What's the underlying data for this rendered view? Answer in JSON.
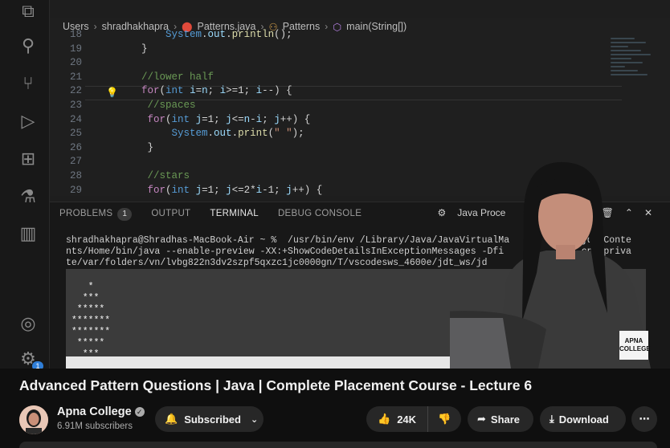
{
  "breadcrumb": [
    "Users",
    "shradhakhapra",
    "Patterns.java",
    "Patterns",
    "main(String[])"
  ],
  "editor": {
    "lines": [
      {
        "n": "18",
        "html": "    <span class='ty'>System</span>.<span class='vr'>out</span>.<span class='fn'>println</span>();"
      },
      {
        "n": "19",
        "html": "}"
      },
      {
        "n": "20",
        "html": ""
      },
      {
        "n": "21",
        "html": "<span class='cm'>//lower half</span>"
      },
      {
        "n": "22",
        "html": "<span class='kw'>for</span>(<span class='ty'>int</span> <span class='vr'>i</span>=<span class='vr'>n</span>; <span class='vr'>i</span>&gt;=1; <span class='vr'>i</span>--) {"
      },
      {
        "n": "23",
        "html": " <span class='cm'>//spaces</span>"
      },
      {
        "n": "24",
        "html": " <span class='kw'>for</span>(<span class='ty'>int</span> <span class='vr'>j</span>=1; <span class='vr'>j</span>&lt;=<span class='vr'>n</span>-<span class='vr'>i</span>; <span class='vr'>j</span>++) {"
      },
      {
        "n": "25",
        "html": "     <span class='ty'>System</span>.<span class='vr'>out</span>.<span class='fn'>print</span>(<span class='st'>\" \"</span>);"
      },
      {
        "n": "26",
        "html": " }"
      },
      {
        "n": "27",
        "html": ""
      },
      {
        "n": "28",
        "html": " <span class='cm'>//stars</span>"
      },
      {
        "n": "29",
        "html": " <span class='kw'>for</span>(<span class='ty'>int</span> <span class='vr'>j</span>=1; <span class='vr'>j</span>&lt;=2*<span class='vr'>i</span>-1; <span class='vr'>j</span>++) {"
      }
    ]
  },
  "panel": {
    "problems": "PROBLEMS",
    "problems_count": "1",
    "output": "OUTPUT",
    "terminal": "TERMINAL",
    "debug_console": "DEBUG CONSOLE",
    "java_process": "Java Proce"
  },
  "terminal": {
    "line1": "shradhakhapra@Shradhas-MacBook-Air ~ %  /usr/bin/env /Library/Java/JavaVirtualMa          .1.jdk/Conte",
    "line2": "nts/Home/bin/java --enable-preview -XX:+ShowCodeDetailsInExceptionMessages -Dfi              cp /priva",
    "line3": "te/var/folders/vn/lvbg822n3dv2szpf5qxzc1jc0000gn/T/vscodesws_4600e/jdt_ws/jd            atterns",
    "output": [
      "    *",
      "   ***",
      "  *****",
      " *******",
      " *******",
      "  *****",
      "   ***",
      "    *"
    ]
  },
  "watermark": "APNA COLLEGE",
  "video_title": "Advanced Pattern Questions | Java | Complete Placement Course - Lecture 6",
  "channel": {
    "name": "Apna College",
    "subscribers": "6.91M subscribers"
  },
  "actions": {
    "subscribed": "Subscribed",
    "likes": "24K",
    "share": "Share",
    "download": "Download"
  },
  "colors": {
    "accent": "#2f7ed8",
    "background": "#0f0f0f",
    "pill": "#272727"
  }
}
